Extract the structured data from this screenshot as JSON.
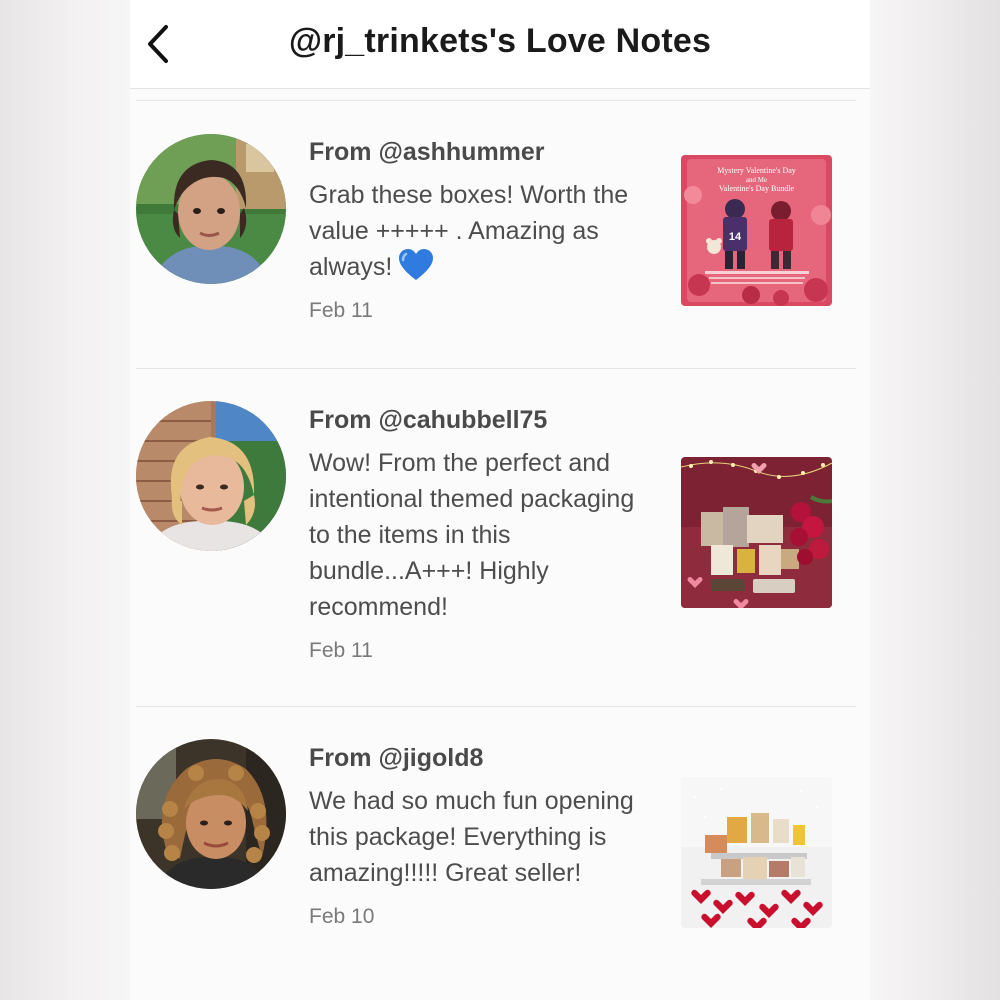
{
  "header": {
    "title": "@rj_trinkets's Love Notes",
    "back_icon": "chevron-left-icon"
  },
  "notes": [
    {
      "from": "From @ashhummer",
      "message": "Grab these boxes! Worth the value +++++ . Amazing as always!",
      "emoji": "blue-heart-icon",
      "date": "Feb 11",
      "thumb_caption_1": "Mystery Valentine's Day",
      "thumb_caption_2": "and Me",
      "thumb_caption_3": "Valentine's Day Bundle",
      "thumb_jersey": "14"
    },
    {
      "from": "From @cahubbell75",
      "message": "Wow! From the perfect and intentional themed packaging to the items in this bundle...A+++! Highly recommend!",
      "date": "Feb 11"
    },
    {
      "from": "From @jigold8",
      "message": "We had so much fun opening this package! Everything is amazing!!!!! Great seller!",
      "date": "Feb 10"
    }
  ],
  "colors": {
    "blue_heart": "#2f7be0",
    "title_text": "#1a1a1a",
    "body_text": "#4d4d4d",
    "date_text": "#7a7a7a"
  }
}
